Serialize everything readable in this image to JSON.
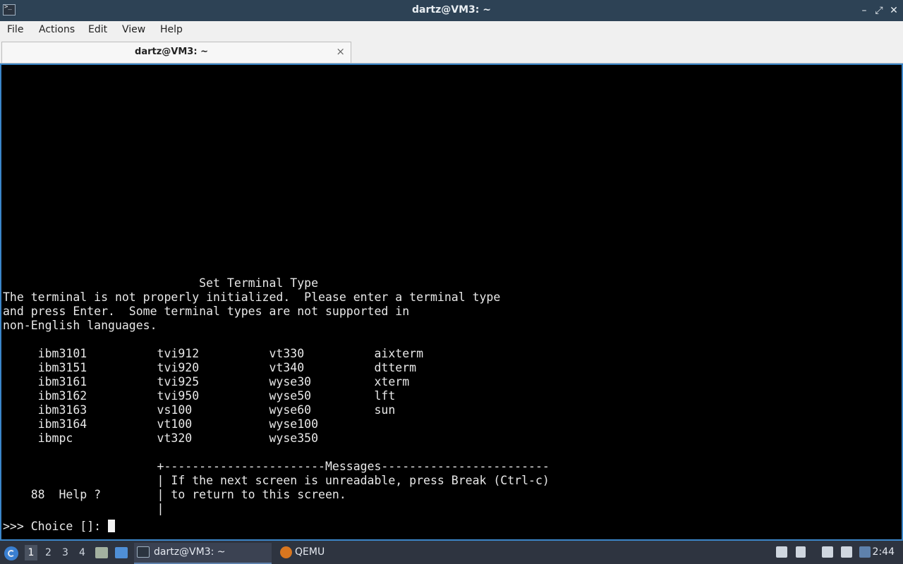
{
  "window": {
    "title": "dartz@VM3: ~",
    "minimize": "–",
    "maximize": "⤢",
    "close": "✕"
  },
  "menu": {
    "file": "File",
    "actions": "Actions",
    "edit": "Edit",
    "view": "View",
    "help": "Help"
  },
  "tab": {
    "label": "dartz@VM3: ~",
    "close": "×"
  },
  "terminal": {
    "lines": [
      "                            Set Terminal Type",
      "The terminal is not properly initialized.  Please enter a terminal type",
      "and press Enter.  Some terminal types are not supported in",
      "non-English languages.",
      "",
      "     ibm3101          tvi912          vt330          aixterm",
      "     ibm3151          tvi920          vt340          dtterm",
      "     ibm3161          tvi925          wyse30         xterm",
      "     ibm3162          tvi950          wyse50         lft",
      "     ibm3163          vs100           wyse60         sun",
      "     ibm3164          vt100           wyse100",
      "     ibmpc            vt320           wyse350",
      "",
      "                      +-----------------------Messages------------------------",
      "                      | If the next screen is unreadable, press Break (Ctrl-c)",
      "    88  Help ?        | to return to this screen.",
      "                      |"
    ],
    "prompt": ">>> Choice []: "
  },
  "taskbar": {
    "workspaces": [
      "1",
      "2",
      "3",
      "4"
    ],
    "tasks": [
      {
        "label": "dartz@VM3: ~"
      },
      {
        "label": "QEMU"
      }
    ],
    "clock": "2:44"
  },
  "colors": {
    "title_bar": "#2d4255",
    "terminal_bg": "#000000",
    "terminal_border": "#3b86c9",
    "taskbar": "#2e3440"
  }
}
